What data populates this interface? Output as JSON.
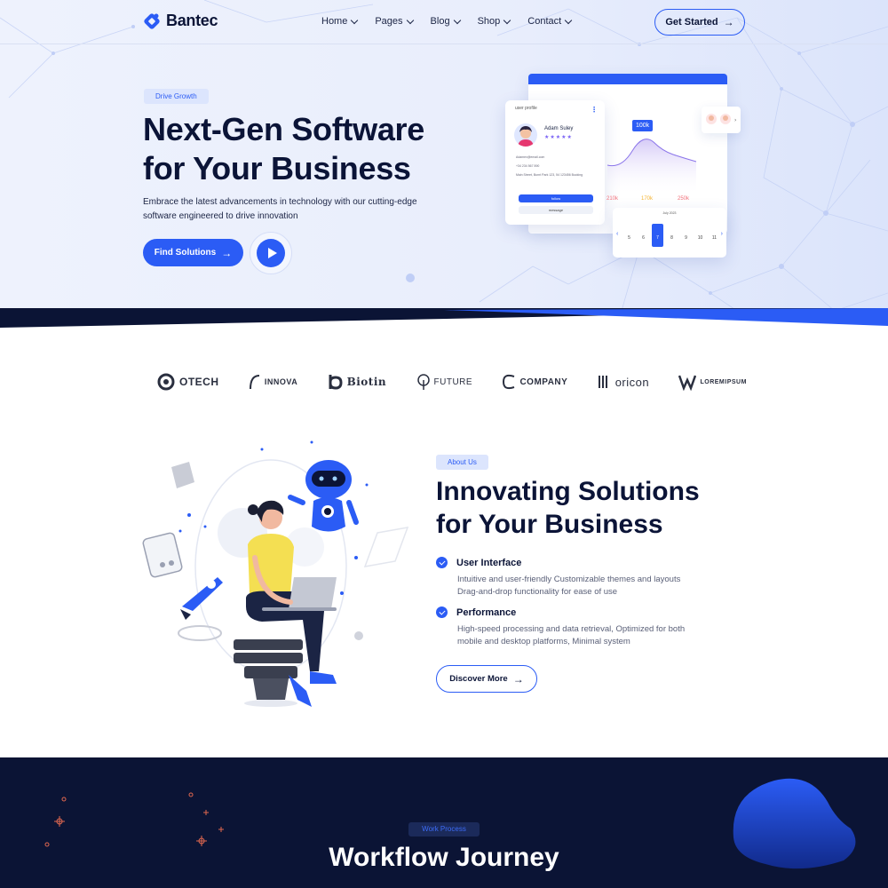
{
  "brand": {
    "name": "Bantec"
  },
  "nav": {
    "items": [
      {
        "label": "Home"
      },
      {
        "label": "Pages"
      },
      {
        "label": "Blog"
      },
      {
        "label": "Shop"
      },
      {
        "label": "Contact"
      }
    ],
    "cta": "Get Started"
  },
  "hero": {
    "tag": "Drive Growth",
    "title_line1": "Next-Gen Software",
    "title_line2": "for Your Business",
    "subtitle": "Embrace the latest advancements in technology with our cutting-edge software engineered to drive innovation",
    "primary_button": "Find Solutions"
  },
  "dashboard": {
    "profile_title": "user profile",
    "profile_name": "Adam Suley",
    "stars": "★★★★★",
    "email": "Adamex@email.com",
    "phone": "+34 234 567 890",
    "address": "Main Street, Burnt Park 123, 54 123456 Bucking",
    "follow": "follow",
    "message": "message",
    "chart_value": "100k",
    "stats": [
      "210k",
      "170k",
      "250k"
    ],
    "calendar_month": "July 2023",
    "calendar_days": [
      "5",
      "6",
      "7",
      "8",
      "9",
      "10",
      "11"
    ],
    "selected_day": "7"
  },
  "partners": [
    {
      "name": "OTECH"
    },
    {
      "name": "INNOVA"
    },
    {
      "name": "Biotin"
    },
    {
      "name": "FUTURE"
    },
    {
      "name": "COMPANY"
    },
    {
      "name": "oricon"
    },
    {
      "name": "LOREMIPSUM"
    }
  ],
  "about": {
    "tag": "About Us",
    "title_line1": "Innovating Solutions",
    "title_line2": "for Your Business",
    "features": [
      {
        "title": "User Interface",
        "desc": "Intuitive and user-friendly Customizable themes and layouts Drag-and-drop functionality for ease of use"
      },
      {
        "title": "Performance",
        "desc": "High-speed processing and data retrieval, Optimized for both mobile and desktop platforms, Minimal system"
      }
    ],
    "button": "Discover More"
  },
  "workflow": {
    "tag": "Work Process",
    "title": "Workflow Journey"
  },
  "colors": {
    "accent": "#2b5cf5",
    "dark": "#0b1437",
    "navy_section": "#0b1435"
  }
}
